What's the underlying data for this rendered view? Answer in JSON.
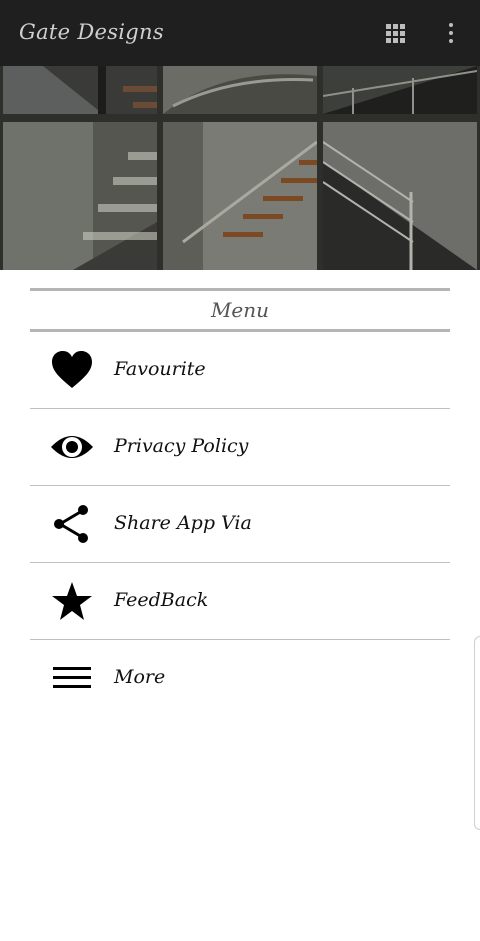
{
  "appbar": {
    "title": "Gate Designs",
    "icons": [
      "grid-icon",
      "overflow-menu-icon"
    ],
    "background": "#1f1f1f"
  },
  "menu": {
    "header": "Menu",
    "items": [
      {
        "label": "Favourite",
        "icon": "heart-icon"
      },
      {
        "label": "Privacy Policy",
        "icon": "eye-icon"
      },
      {
        "label": "Share App Via",
        "icon": "share-icon"
      },
      {
        "label": "FeedBack",
        "icon": "star-icon"
      },
      {
        "label": "More",
        "icon": "hamburger-icon"
      }
    ]
  }
}
